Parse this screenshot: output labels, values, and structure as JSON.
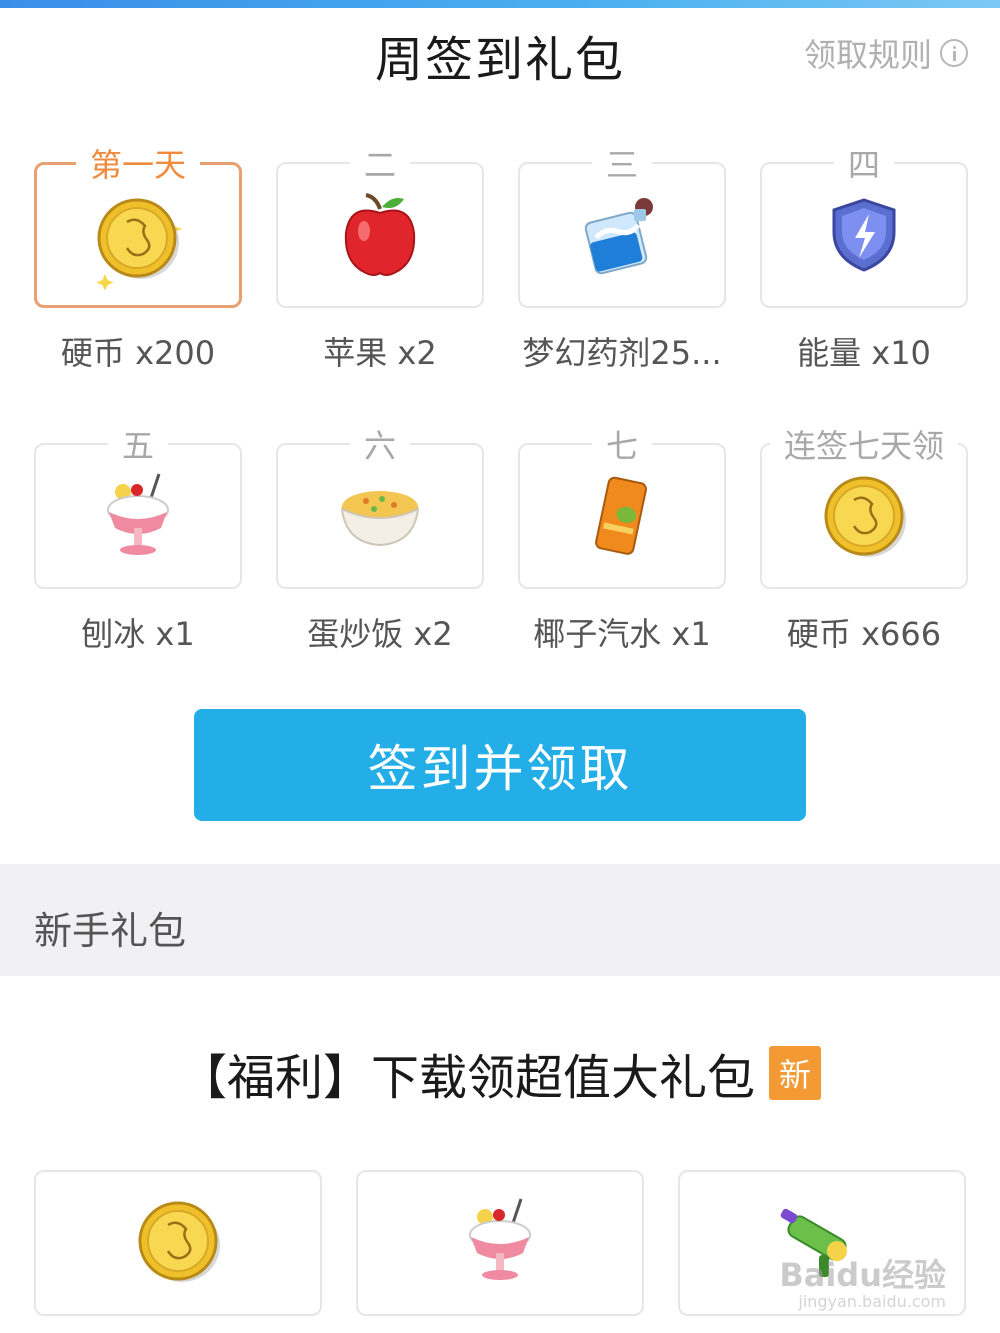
{
  "header": {
    "title": "周签到礼包",
    "rules_label": "领取规则"
  },
  "days": [
    {
      "tag": "第一天",
      "name": "硬币 x200",
      "icon": "coin-icon",
      "active": true
    },
    {
      "tag": "二",
      "name": "苹果 x2",
      "icon": "apple-icon",
      "active": false
    },
    {
      "tag": "三",
      "name": "梦幻药剂25...",
      "icon": "potion-icon",
      "active": false
    },
    {
      "tag": "四",
      "name": "能量 x10",
      "icon": "energy-shield-icon",
      "active": false
    },
    {
      "tag": "五",
      "name": "刨冰 x1",
      "icon": "shaved-ice-icon",
      "active": false
    },
    {
      "tag": "六",
      "name": "蛋炒饭 x2",
      "icon": "fried-rice-icon",
      "active": false
    },
    {
      "tag": "七",
      "name": "椰子汽水 x1",
      "icon": "coconut-soda-icon",
      "active": false
    },
    {
      "tag": "连签七天领",
      "name": "硬币 x666",
      "icon": "coin-icon",
      "active": false
    }
  ],
  "cta": {
    "label": "签到并领取"
  },
  "section": {
    "title": "新手礼包"
  },
  "promo": {
    "title": "【福利】下载领超值大礼包",
    "badge": "新",
    "items": [
      {
        "icon": "coin-icon"
      },
      {
        "icon": "shaved-ice-icon"
      },
      {
        "icon": "water-gun-icon"
      }
    ]
  },
  "watermark": {
    "text": "Baidu经验",
    "sub": "jingyan.baidu.com"
  },
  "colors": {
    "accent": "#23aee8",
    "active_border": "#e8a070",
    "active_tag": "#f08a3c",
    "badge": "#f49a34"
  }
}
